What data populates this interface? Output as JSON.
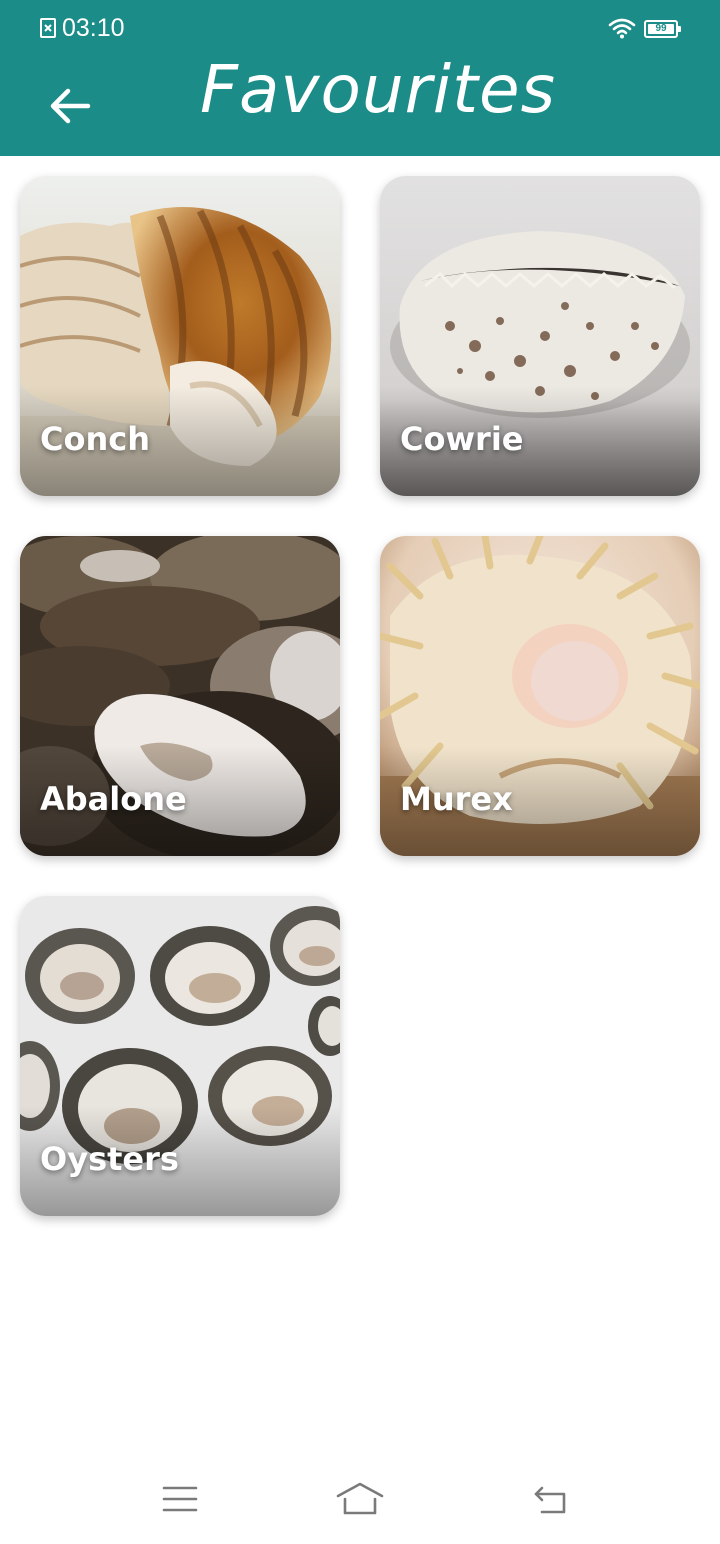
{
  "status_bar": {
    "time": "03:10",
    "battery": "99",
    "icons": [
      "sim-alert-icon",
      "wifi-icon",
      "battery-icon"
    ]
  },
  "header": {
    "title": "Favourites",
    "back_icon": "arrow-left-icon",
    "background": "#1b8c88"
  },
  "favourites": [
    {
      "name": "Conch"
    },
    {
      "name": "Cowrie"
    },
    {
      "name": "Abalone"
    },
    {
      "name": "Murex"
    },
    {
      "name": "Oysters"
    }
  ],
  "nav_bar": {
    "icons": [
      "menu-icon",
      "home-icon",
      "back-icon"
    ]
  }
}
